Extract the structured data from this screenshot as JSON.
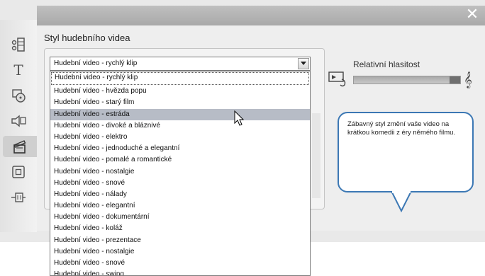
{
  "window": {
    "close_glyph": "✕"
  },
  "sidebar": {
    "tabs": [
      {
        "name": "scissors-film-icon"
      },
      {
        "name": "title-text-icon"
      },
      {
        "name": "disc-icon"
      },
      {
        "name": "audio-icon"
      },
      {
        "name": "music-video-clapper-icon",
        "active": true
      },
      {
        "name": "frame-icon"
      },
      {
        "name": "transition-icon"
      }
    ],
    "title_tab_glyph": "T"
  },
  "panel": {
    "title": "Styl hudebního videa"
  },
  "style_combo": {
    "value": "Hudební video - rychlý klip",
    "options": [
      "Hudební video - rychlý klip",
      "Hudební video - hvězda popu",
      "Hudební video - starý film",
      "Hudební video - estráda",
      "Hudební video - divoké a bláznivé",
      "Hudební video - elektro",
      "Hudební video - jednoduché a elegantní",
      "Hudební video - pomalé a romantické",
      "Hudební video - nostalgie",
      "Hudební video - snové",
      "Hudební video - nálady",
      "Hudební video - elegantní",
      "Hudební video - dokumentární",
      "Hudební video - koláž",
      "Hudební video - prezentace",
      "Hudební video - nostalgie",
      "Hudební video - snové",
      "Hudební video - swing"
    ],
    "highlighted_index": 3
  },
  "volume": {
    "label": "Relativní hlasitost",
    "note_glyph": "𝄞",
    "level_fraction": 0.9
  },
  "description": {
    "text": "Zábavný styl změní vaše video na krátkou komedii z éry němého filmu."
  },
  "colors": {
    "highlight": "#b7bcc6",
    "bubble_border": "#3c78b4"
  }
}
